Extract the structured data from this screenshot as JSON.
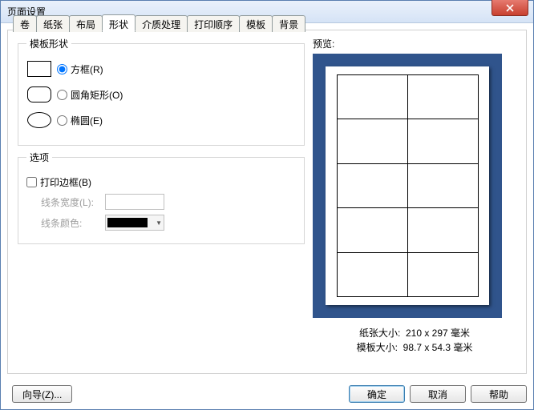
{
  "window": {
    "title": "页面设置"
  },
  "tabs": [
    "卷",
    "纸张",
    "布局",
    "形状",
    "介质处理",
    "打印顺序",
    "模板",
    "背景"
  ],
  "active_tab_index": 3,
  "groups": {
    "shape_legend": "模板形状",
    "options_legend": "选项"
  },
  "shapes": {
    "rect": "方框(R)",
    "rrect": "圆角矩形(O)",
    "ellipse": "椭圆(E)",
    "selected": "rect"
  },
  "options": {
    "print_border": "打印边框(B)",
    "print_border_checked": false,
    "line_width_label": "线条宽度(L):",
    "line_width_value": "",
    "line_color_label": "线条颜色:",
    "line_color_value": "#000000"
  },
  "preview": {
    "label": "预览:",
    "paper_size_label": "纸张大小:",
    "paper_size_value": "210 x 297 毫米",
    "template_size_label": "模板大小:",
    "template_size_value": "98.7 x 54.3 毫米"
  },
  "buttons": {
    "wizard": "向导(Z)...",
    "ok": "确定",
    "cancel": "取消",
    "help": "帮助"
  }
}
